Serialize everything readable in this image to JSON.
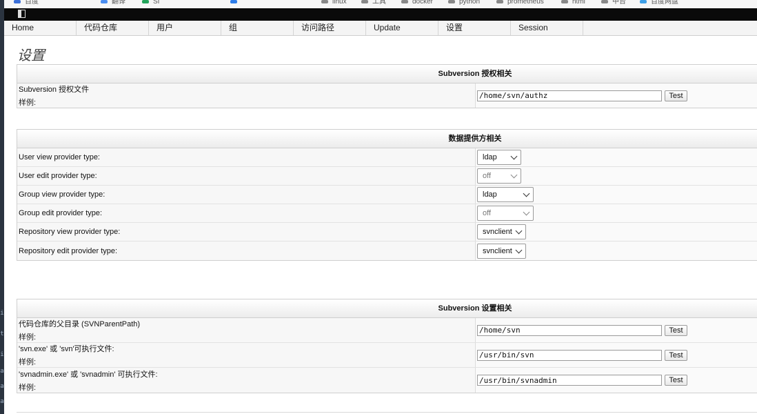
{
  "bookmarks": [
    "百度",
    "翻译",
    "SI",
    "",
    "",
    "linux",
    "工具",
    "docker",
    "python",
    "prometheus",
    "html",
    "中台",
    "百度网盘"
  ],
  "left_strip_glyphs": [
    "i",
    "t",
    "i",
    "a",
    "a",
    "a"
  ],
  "nav": [
    "Home",
    "代码仓库",
    "用户",
    "组",
    "访问路径",
    "Update",
    "设置",
    "Session"
  ],
  "page_title": "设置",
  "authz": {
    "header": "Subversion 授权相关",
    "rows": [
      {
        "label": "Subversion 授权文件",
        "sub": "样例:",
        "value": "/home/svn/authz",
        "button": "Test"
      }
    ]
  },
  "providers": {
    "header": "数据提供方相关",
    "rows": [
      {
        "label": "User view provider type:",
        "value": "ldap",
        "disabled": false
      },
      {
        "label": "User edit provider type:",
        "value": "off",
        "disabled": true
      },
      {
        "label": "Group view provider type:",
        "value": "ldap",
        "disabled": false
      },
      {
        "label": "Group edit provider type:",
        "value": "off",
        "disabled": true
      },
      {
        "label": "Repository view provider type:",
        "value": "svnclient",
        "disabled": false
      },
      {
        "label": "Repository edit provider type:",
        "value": "svnclient",
        "disabled": false
      }
    ]
  },
  "svn_settings": {
    "header": "Subversion 设置相关",
    "rows": [
      {
        "label": "代码仓库的父目录 (SVNParentPath)",
        "sub": "样例:",
        "value": "/home/svn",
        "button": "Test"
      },
      {
        "label": "'svn.exe' 或 'svn'可执行文件:",
        "sub": "样例:",
        "value": "/usr/bin/svn",
        "button": "Test"
      },
      {
        "label": "'svnadmin.exe' 或 'svnadmin' 可执行文件:",
        "sub": "样例:",
        "value": "/usr/bin/svnadmin",
        "button": "Test"
      }
    ]
  }
}
